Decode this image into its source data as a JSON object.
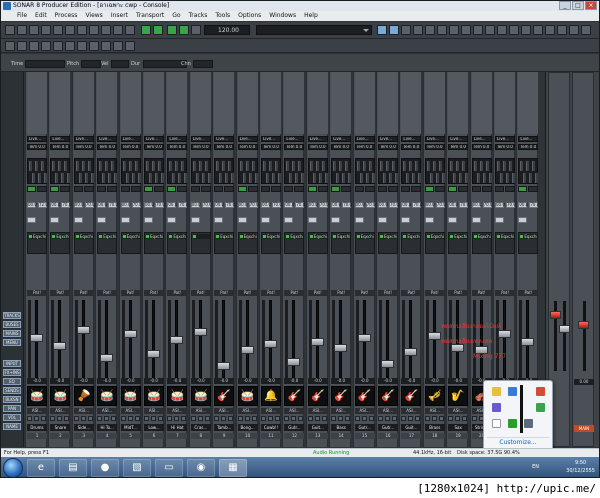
{
  "window": {
    "title": "SONAR 8 Producer Edition - [อาเฉพาะ cwp - Console]",
    "buttons": [
      "_",
      "□",
      "×"
    ]
  },
  "menu": [
    "File",
    "Edit",
    "Process",
    "Views",
    "Insert",
    "Transport",
    "Go",
    "Tracks",
    "Tools",
    "Options",
    "Windows",
    "Help"
  ],
  "toolbar": {
    "tempo": "120.00",
    "project_selector": ""
  },
  "fields": {
    "time": "Time",
    "pitch": "Pitch",
    "vel": "Vel",
    "dur": "Dur",
    "chn": "Chn"
  },
  "left_strip": [
    "TRACKS",
    "BUSES",
    "MAINS",
    "MENU",
    "INPUT",
    "FX+INS",
    "EQ",
    "SENDS",
    "BLKSN",
    "PAN",
    "VOL",
    "NAME"
  ],
  "strips": [
    {
      "input": "Live...",
      "output": "Tem 0.0",
      "num1": "00.0",
      "num2": "72.0",
      "fx": "Eqxchi",
      "pan": "Pat!",
      "vol": "-0.0",
      "icon": "🥁",
      "out": "ASI...",
      "name": "Drums",
      "chn": "1"
    },
    {
      "input": "Live...",
      "output": "Tem 0.0",
      "num1": "00.0",
      "num2": "70.0",
      "fx": "Eqxchi",
      "pan": "Pat!",
      "vol": "-0.0",
      "icon": "🥁",
      "out": "ASI...",
      "name": "Snare",
      "chn": "2"
    },
    {
      "input": "Live...",
      "output": "Tem 0.0",
      "num1": "00.0",
      "num2": "70.0",
      "fx": "Eqxchi",
      "pan": "Pat!",
      "vol": "-0.0",
      "icon": "🪘",
      "out": "ASI...",
      "name": "Side...",
      "chn": "3"
    },
    {
      "input": "Live...",
      "output": "Tem 0.0",
      "num1": "00.0",
      "num2": "70.0",
      "fx": "Eqxchi",
      "pan": "Pat!",
      "vol": "-0.0",
      "icon": "🥁",
      "out": "ASI...",
      "name": "Hi To...",
      "chn": "4"
    },
    {
      "input": "Live...",
      "output": "Tem 0.0",
      "num1": "00.0",
      "num2": "70.0",
      "fx": "Eqxchi",
      "pan": "Pat!",
      "vol": "-0.0",
      "icon": "🥁",
      "out": "ASI...",
      "name": "MidT...",
      "chn": "5"
    },
    {
      "input": "Live...",
      "output": "Tem 0.0",
      "num1": "00.0",
      "num2": "70.0",
      "fx": "Eqxchi",
      "pan": "Pat!",
      "vol": "-0.0",
      "icon": "🥁",
      "out": "ASI...",
      "name": "Low...",
      "chn": "6"
    },
    {
      "input": "Live...",
      "output": "Tem 0.0",
      "num1": "00.0",
      "num2": "70.0",
      "fx": "Eqxchi",
      "pan": "Pat!",
      "vol": "-0.0",
      "icon": "🥁",
      "out": "ASI...",
      "name": "Hi Hat",
      "chn": "7"
    },
    {
      "input": "Live...",
      "output": "Tem 0.0",
      "num1": "00.0",
      "num2": "70.0",
      "fx": "",
      "pan": "Pat!",
      "vol": "-0.0",
      "icon": "🥁",
      "out": "ASI...",
      "name": "Cras...",
      "chn": "8"
    },
    {
      "input": "Live...",
      "output": "Tem 0.0",
      "num1": "00.0",
      "num2": "70.0",
      "fx": "Eqxchi",
      "pan": "Pat!",
      "vol": "-0.0",
      "icon": "🎸",
      "out": "ASI...",
      "name": "Tamb...",
      "chn": "9"
    },
    {
      "input": "Live...",
      "output": "Tem 0.0",
      "num1": "00.0",
      "num2": "70.0",
      "fx": "Eqxchi",
      "pan": "Pat!",
      "vol": "-0.0",
      "icon": "🥁",
      "out": "ASI...",
      "name": "Bong...",
      "chn": "10"
    },
    {
      "input": "Live...",
      "output": "Tem 0.0",
      "num1": "00.0",
      "num2": "70.0",
      "fx": "Eqxchi",
      "pan": "Pat!",
      "vol": "-0.0",
      "icon": "🔔",
      "out": "ASI...",
      "name": "Cowb!!",
      "chn": "11"
    },
    {
      "input": "Live...",
      "output": "Tem 0.0",
      "num1": "00.0",
      "num2": "70.0",
      "fx": "Eqxchi",
      "pan": "Pat!",
      "vol": "-0.0",
      "icon": "🎸",
      "out": "ASI...",
      "name": "Gutr...",
      "chn": "12"
    },
    {
      "input": "Live...",
      "output": "Tem 0.0",
      "num1": "00.0",
      "num2": "70.0",
      "fx": "Eqxchi",
      "pan": "Pat!",
      "vol": "-0.0",
      "icon": "🎸",
      "out": "ASI...",
      "name": "Guit...",
      "chn": "13"
    },
    {
      "input": "Live...",
      "output": "Tem 0.0",
      "num1": "00.0",
      "num2": "70.0",
      "fx": "Eqxchi",
      "pan": "Pat!",
      "vol": "-0.0",
      "icon": "🎸",
      "out": "ASI...",
      "name": "Bass",
      "chn": "14"
    },
    {
      "input": "Live...",
      "output": "Tem 0.0",
      "num1": "00.0",
      "num2": "70.0",
      "fx": "Eqxchi",
      "pan": "Pat!",
      "vol": "-0.0",
      "icon": "🎸",
      "out": "ASI...",
      "name": "Gutr...",
      "chn": "15"
    },
    {
      "input": "Live...",
      "output": "Tem 0.0",
      "num1": "00.0",
      "num2": "70.0",
      "fx": "Eqxchi",
      "pan": "Pat!",
      "vol": "-0.0",
      "icon": "🎸",
      "out": "ASI...",
      "name": "Gutr...",
      "chn": "16"
    },
    {
      "input": "Live...",
      "output": "Tem 0.0",
      "num1": "00.0",
      "num2": "70.0",
      "fx": "Eqxchi",
      "pan": "Pat!",
      "vol": "-0.0",
      "icon": "🎸",
      "out": "ASI...",
      "name": "Guit...",
      "chn": "17"
    },
    {
      "input": "Live...",
      "output": "Tem 0.0",
      "num1": "00.0",
      "num2": "70.0",
      "fx": "Eqxchi",
      "pan": "Pat!",
      "vol": "-0.0",
      "icon": "🎺",
      "out": "ASI...",
      "name": "Brass",
      "chn": "18"
    },
    {
      "input": "Live...",
      "output": "Tem 0.0",
      "num1": "00.0",
      "num2": "70.0",
      "fx": "Eqxchi",
      "pan": "Pat!",
      "vol": "-0.0",
      "icon": "🎷",
      "out": "ASI...",
      "name": "Sax",
      "chn": "19"
    },
    {
      "input": "Live...",
      "output": "Tem 0.0",
      "num1": "00.0",
      "num2": "70.0",
      "fx": "Eqxchi",
      "pan": "Pat!",
      "vol": "-0.0",
      "icon": "🎻",
      "out": "ASI...",
      "name": "Strin...",
      "chn": "20"
    },
    {
      "input": "Live...",
      "output": "Tem 0.0",
      "num1": "00.0",
      "num2": "70.0",
      "fx": "Eqxchi",
      "pan": "Pat!",
      "vol": "-0.0",
      "icon": "🎹",
      "out": "ASI...",
      "name": "Piano",
      "chn": "21"
    },
    {
      "input": "Live...",
      "output": "Tem 0.0",
      "num1": "00.0",
      "num2": "70.0",
      "fx": "Eqxchi",
      "pan": "Pat!",
      "vol": "-0.0",
      "icon": "🎹",
      "out": "ASI...",
      "name": "Synth",
      "chn": "22"
    }
  ],
  "master": {
    "label": "Mas...",
    "out": "MAIN",
    "value": "0.00"
  },
  "red_text": [
    "ทดสอบเสียงกลองไม้แท้",
    "ทดสอบเสียงเพลงสด",
    "Mixing  777"
  ],
  "tray_popup": {
    "customize": "Customize..."
  },
  "status": {
    "left": "For Help, press F1",
    "center": "Audio Running",
    "rate": "44.1kHz, 16-bit",
    "disk": "Disk space: 37.5G 90.4%"
  },
  "taskbar": {
    "lang": "EN",
    "time": "9:50",
    "date": "30/12/2555"
  },
  "watermark": "[1280x1024] http://upic.me/"
}
